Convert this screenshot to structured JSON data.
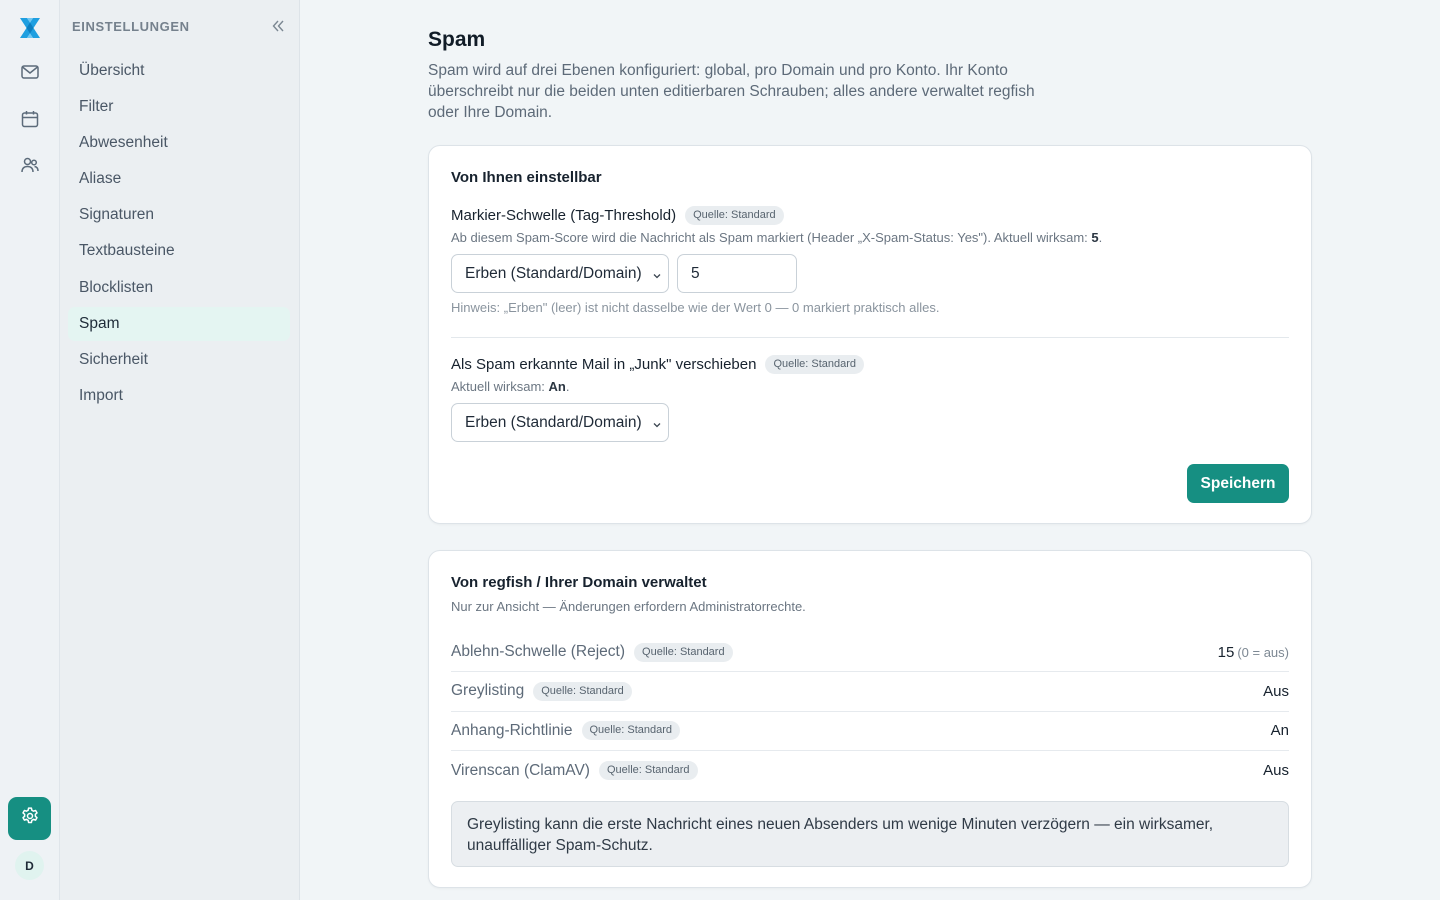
{
  "rail": {
    "icons": [
      "logo-icon",
      "mail-icon",
      "calendar-icon",
      "contacts-icon",
      "gear-icon"
    ],
    "avatar_initial": "D",
    "accent": "#168f82"
  },
  "sidebar": {
    "title": "EINSTELLUNGEN",
    "items": [
      {
        "label": "Übersicht"
      },
      {
        "label": "Filter"
      },
      {
        "label": "Abwesenheit"
      },
      {
        "label": "Aliase"
      },
      {
        "label": "Signaturen"
      },
      {
        "label": "Textbausteine"
      },
      {
        "label": "Blocklisten"
      },
      {
        "label": "Spam",
        "active": true
      },
      {
        "label": "Sicherheit"
      },
      {
        "label": "Import"
      }
    ]
  },
  "page": {
    "title": "Spam",
    "description": "Spam wird auf drei Ebenen konfiguriert: global, pro Domain und pro Konto. Ihr Konto überschreibt nur die beiden unten editierbaren Schrauben; alles andere verwaltet regfish oder Ihre Domain."
  },
  "editable": {
    "title": "Von Ihnen einstellbar",
    "tag_threshold": {
      "label": "Markier-Schwelle (Tag-Threshold)",
      "badge": "Quelle: Standard",
      "help_prefix": "Ab diesem Spam-Score wird die Nachricht als Spam markiert (Header „X-Spam-Status: Yes\"). Aktuell wirksam: ",
      "help_value": "5",
      "help_suffix": ".",
      "select_value": "Erben (Standard/Domain)",
      "input_value": "5",
      "hint": "Hinweis: „Erben\" (leer) ist nicht dasselbe wie der Wert 0 — 0 markiert praktisch alles."
    },
    "junk_move": {
      "label": "Als Spam erkannte Mail in „Junk\" verschieben",
      "badge": "Quelle: Standard",
      "help_prefix": "Aktuell wirksam: ",
      "help_value": "An",
      "help_suffix": ".",
      "select_value": "Erben (Standard/Domain)"
    },
    "save_label": "Speichern"
  },
  "managed": {
    "title": "Von regfish / Ihrer Domain verwaltet",
    "subtitle": "Nur zur Ansicht — Änderungen erfordern Administratorrechte.",
    "rows": [
      {
        "label": "Ablehn-Schwelle (Reject)",
        "badge": "Quelle: Standard",
        "value": "15",
        "suffix": "(0 = aus)"
      },
      {
        "label": "Greylisting",
        "badge": "Quelle: Standard",
        "value": "Aus",
        "suffix": ""
      },
      {
        "label": "Anhang-Richtlinie",
        "badge": "Quelle: Standard",
        "value": "An",
        "suffix": ""
      },
      {
        "label": "Virenscan (ClamAV)",
        "badge": "Quelle: Standard",
        "value": "Aus",
        "suffix": ""
      }
    ],
    "info": "Greylisting kann die erste Nachricht eines neuen Absenders um wenige Minuten verzögern — ein wirksamer, unauffälliger Spam-Schutz."
  }
}
